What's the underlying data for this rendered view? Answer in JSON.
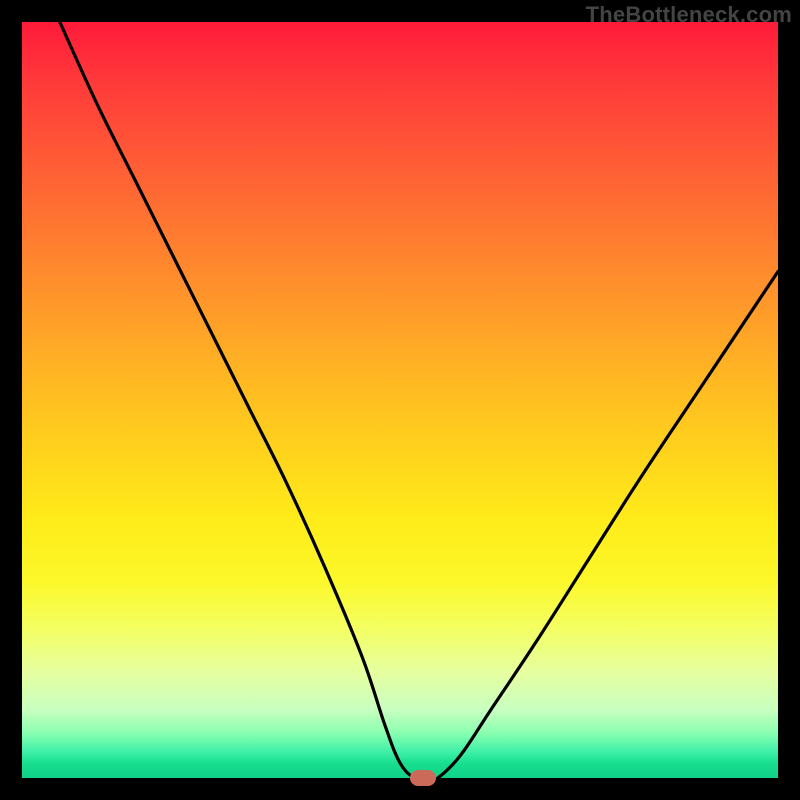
{
  "watermark": "TheBottleneck.com",
  "chart_data": {
    "type": "line",
    "title": "",
    "xlabel": "",
    "ylabel": "",
    "xlim": [
      0,
      100
    ],
    "ylim": [
      0,
      100
    ],
    "grid": false,
    "legend": false,
    "background_gradient": {
      "top": "#ff1a3a",
      "mid": "#ffec1a",
      "bottom": "#10d088"
    },
    "series": [
      {
        "name": "bottleneck-curve",
        "color": "#000000",
        "x": [
          5,
          10,
          15,
          20,
          25,
          30,
          35,
          40,
          45,
          48,
          50,
          52,
          54,
          55,
          58,
          62,
          68,
          75,
          82,
          90,
          100
        ],
        "y": [
          100,
          89,
          79,
          69,
          59,
          49,
          39,
          28,
          16,
          7,
          2,
          0,
          0,
          0,
          3,
          9,
          18,
          29,
          40,
          52,
          67
        ]
      }
    ],
    "marker": {
      "x": 53,
      "y": 0,
      "color": "#cc6a5a"
    }
  }
}
